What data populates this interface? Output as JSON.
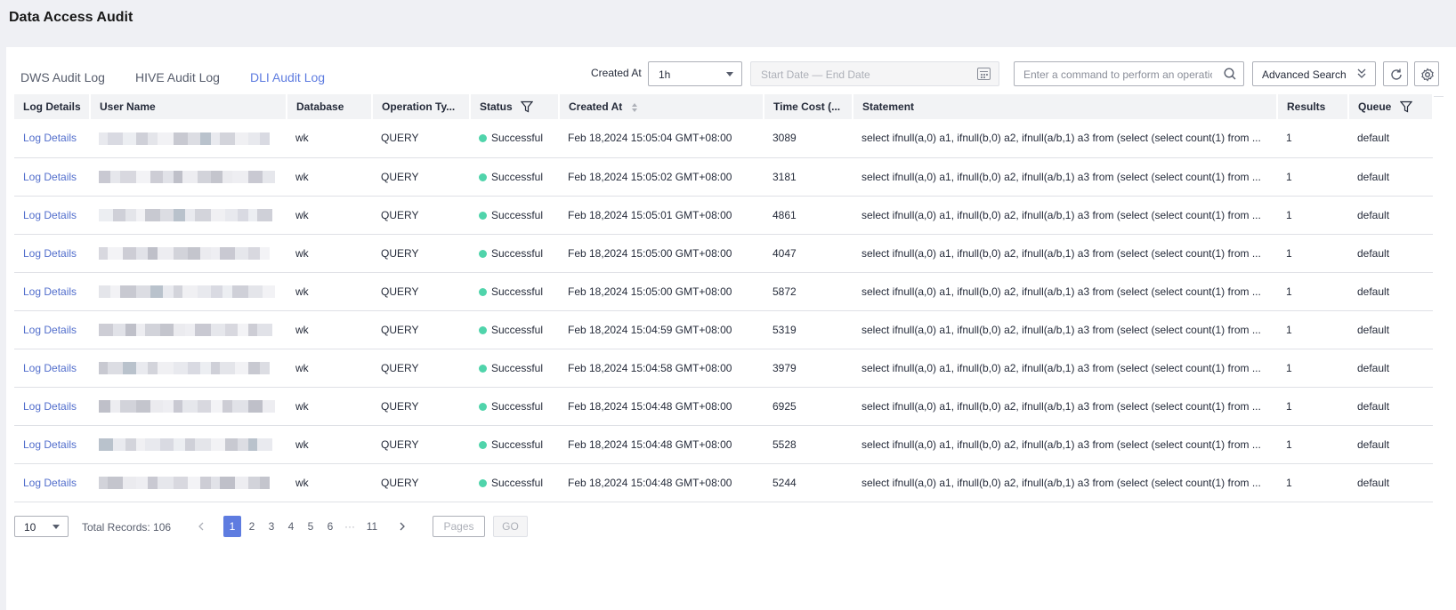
{
  "page": {
    "title": "Data Access Audit"
  },
  "tabs": [
    {
      "label": "DWS Audit Log",
      "active": false
    },
    {
      "label": "HIVE Audit Log",
      "active": false
    },
    {
      "label": "DLI Audit Log",
      "active": true
    }
  ],
  "filters": {
    "created_at_label": "Created At",
    "created_at_value": "1h",
    "date_range_placeholder": "Start Date — End Date",
    "search_placeholder": "Enter a command to perform an operatio",
    "advanced_search_label": "Advanced Search"
  },
  "table": {
    "columns": [
      "Log Details",
      "User Name",
      "Database",
      "Operation Ty... ",
      "Status",
      "Created At",
      "Time Cost (... ",
      "Statement",
      "Results",
      "Queue"
    ],
    "rows": [
      {
        "details": "Log Details",
        "database": "wk",
        "operation": "QUERY",
        "status": "Successful",
        "created_at": "Feb 18,2024 15:05:04 GMT+08:00",
        "time_cost": "3089",
        "statement": "select ifnull(a,0) a1, ifnull(b,0) a2, ifnull(a/b,1) a3 from (select (select count(1) from ...",
        "results": "1",
        "queue": "default"
      },
      {
        "details": "Log Details",
        "database": "wk",
        "operation": "QUERY",
        "status": "Successful",
        "created_at": "Feb 18,2024 15:05:02 GMT+08:00",
        "time_cost": "3181",
        "statement": "select ifnull(a,0) a1, ifnull(b,0) a2, ifnull(a/b,1) a3 from (select (select count(1) from ...",
        "results": "1",
        "queue": "default"
      },
      {
        "details": "Log Details",
        "database": "wk",
        "operation": "QUERY",
        "status": "Successful",
        "created_at": "Feb 18,2024 15:05:01 GMT+08:00",
        "time_cost": "4861",
        "statement": "select ifnull(a,0) a1, ifnull(b,0) a2, ifnull(a/b,1) a3 from (select (select count(1) from ...",
        "results": "1",
        "queue": "default"
      },
      {
        "details": "Log Details",
        "database": "wk",
        "operation": "QUERY",
        "status": "Successful",
        "created_at": "Feb 18,2024 15:05:00 GMT+08:00",
        "time_cost": "4047",
        "statement": "select ifnull(a,0) a1, ifnull(b,0) a2, ifnull(a/b,1) a3 from (select (select count(1) from ...",
        "results": "1",
        "queue": "default"
      },
      {
        "details": "Log Details",
        "database": "wk",
        "operation": "QUERY",
        "status": "Successful",
        "created_at": "Feb 18,2024 15:05:00 GMT+08:00",
        "time_cost": "5872",
        "statement": "select ifnull(a,0) a1, ifnull(b,0) a2, ifnull(a/b,1) a3 from (select (select count(1) from ...",
        "results": "1",
        "queue": "default"
      },
      {
        "details": "Log Details",
        "database": "wk",
        "operation": "QUERY",
        "status": "Successful",
        "created_at": "Feb 18,2024 15:04:59 GMT+08:00",
        "time_cost": "5319",
        "statement": "select ifnull(a,0) a1, ifnull(b,0) a2, ifnull(a/b,1) a3 from (select (select count(1) from ...",
        "results": "1",
        "queue": "default"
      },
      {
        "details": "Log Details",
        "database": "wk",
        "operation": "QUERY",
        "status": "Successful",
        "created_at": "Feb 18,2024 15:04:58 GMT+08:00",
        "time_cost": "3979",
        "statement": "select ifnull(a,0) a1, ifnull(b,0) a2, ifnull(a/b,1) a3 from (select (select count(1) from ...",
        "results": "1",
        "queue": "default"
      },
      {
        "details": "Log Details",
        "database": "wk",
        "operation": "QUERY",
        "status": "Successful",
        "created_at": "Feb 18,2024 15:04:48 GMT+08:00",
        "time_cost": "6925",
        "statement": "select ifnull(a,0) a1, ifnull(b,0) a2, ifnull(a/b,1) a3 from (select (select count(1) from ...",
        "results": "1",
        "queue": "default"
      },
      {
        "details": "Log Details",
        "database": "wk",
        "operation": "QUERY",
        "status": "Successful",
        "created_at": "Feb 18,2024 15:04:48 GMT+08:00",
        "time_cost": "5528",
        "statement": "select ifnull(a,0) a1, ifnull(b,0) a2, ifnull(a/b,1) a3 from (select (select count(1) from ...",
        "results": "1",
        "queue": "default"
      },
      {
        "details": "Log Details",
        "database": "wk",
        "operation": "QUERY",
        "status": "Successful",
        "created_at": "Feb 18,2024 15:04:48 GMT+08:00",
        "time_cost": "5244",
        "statement": "select ifnull(a,0) a1, ifnull(b,0) a2, ifnull(a/b,1) a3 from (select (select count(1) from ...",
        "results": "1",
        "queue": "default"
      }
    ]
  },
  "pagination": {
    "page_size": "10",
    "total_label": "Total Records: 106",
    "pages": [
      "1",
      "2",
      "3",
      "4",
      "5",
      "6",
      "···",
      "11"
    ],
    "current_page": "1",
    "pages_placeholder": "Pages",
    "go_label": "GO"
  },
  "colors": {
    "accent": "#5e7ce0",
    "link": "#526ecc",
    "success": "#50d4ab",
    "header_bg": "#f2f3f5"
  },
  "icons": [
    "filter-icon",
    "sort-icon",
    "search-icon",
    "calendar-icon",
    "double-chevron-down-icon",
    "refresh-icon",
    "settings-icon",
    "chevron-left-icon",
    "chevron-right-icon"
  ]
}
